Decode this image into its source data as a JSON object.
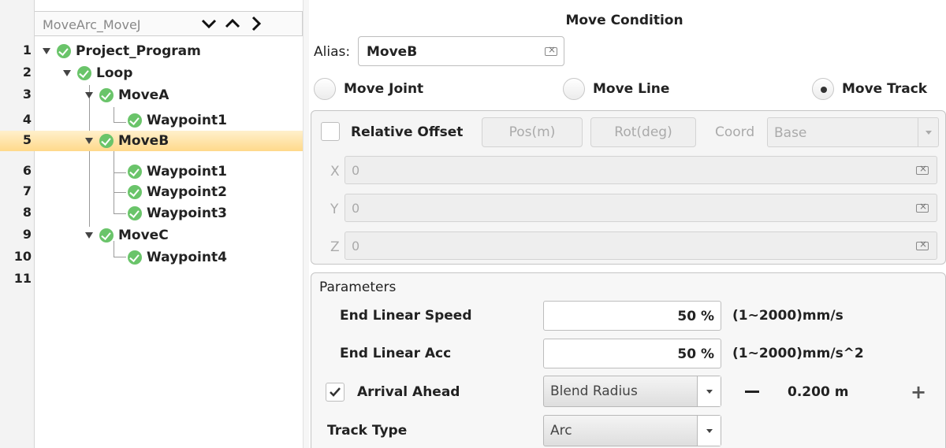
{
  "tree": {
    "header_title": "MoveArc_MoveJ",
    "icons": [
      "chevron-down-icon",
      "chevron-up-icon",
      "chevron-right-icon"
    ],
    "rows": [
      {
        "num": "1",
        "label": "Project_Program",
        "expandable": true,
        "selected": false
      },
      {
        "num": "2",
        "label": "Loop",
        "expandable": true,
        "selected": false
      },
      {
        "num": "3",
        "label": "MoveA",
        "expandable": true,
        "selected": false
      },
      {
        "num": "4",
        "label": "Waypoint1",
        "expandable": false,
        "selected": false
      },
      {
        "num": "5",
        "label": "MoveB",
        "expandable": true,
        "selected": true
      },
      {
        "num": "6",
        "label": "Waypoint1",
        "expandable": false,
        "selected": false
      },
      {
        "num": "7",
        "label": "Waypoint2",
        "expandable": false,
        "selected": false
      },
      {
        "num": "8",
        "label": "Waypoint3",
        "expandable": false,
        "selected": false
      },
      {
        "num": "9",
        "label": "MoveC",
        "expandable": true,
        "selected": false
      },
      {
        "num": "10",
        "label": "Waypoint4",
        "expandable": false,
        "selected": false
      },
      {
        "num": "11",
        "label": "",
        "expandable": false,
        "selected": false
      }
    ]
  },
  "move_condition": {
    "title": "Move Condition",
    "alias_label": "Alias:",
    "alias_value": "MoveB",
    "move_types": [
      "Move Joint",
      "Move Line",
      "Move Track"
    ],
    "selected_move_type": "Move Track"
  },
  "offset": {
    "relative_offset_label": "Relative Offset",
    "relative_offset_checked": false,
    "pos_button": "Pos(m)",
    "rot_button": "Rot(deg)",
    "coord_label": "Coord",
    "coord_value": "Base",
    "axes": [
      {
        "label": "X",
        "value": "0"
      },
      {
        "label": "Y",
        "value": "0"
      },
      {
        "label": "Z",
        "value": "0"
      }
    ]
  },
  "parameters": {
    "title": "Parameters",
    "end_linear_speed_label": "End Linear Speed",
    "end_linear_speed_value": "50 %",
    "end_linear_speed_range": "(1~2000)mm/s",
    "end_linear_acc_label": "End Linear Acc",
    "end_linear_acc_value": "50 %",
    "end_linear_acc_range": "(1~2000)mm/s^2",
    "arrival_ahead_label": "Arrival Ahead",
    "arrival_ahead_checked": true,
    "arrival_mode": "Blend Radius",
    "blend_value": "0.200 m",
    "track_type_label": "Track Type",
    "track_type_value": "Arc"
  },
  "colors": {
    "selection_top": "#fff0cc",
    "selection_bottom": "#ffd98a",
    "check_green": "#6ac46a"
  }
}
